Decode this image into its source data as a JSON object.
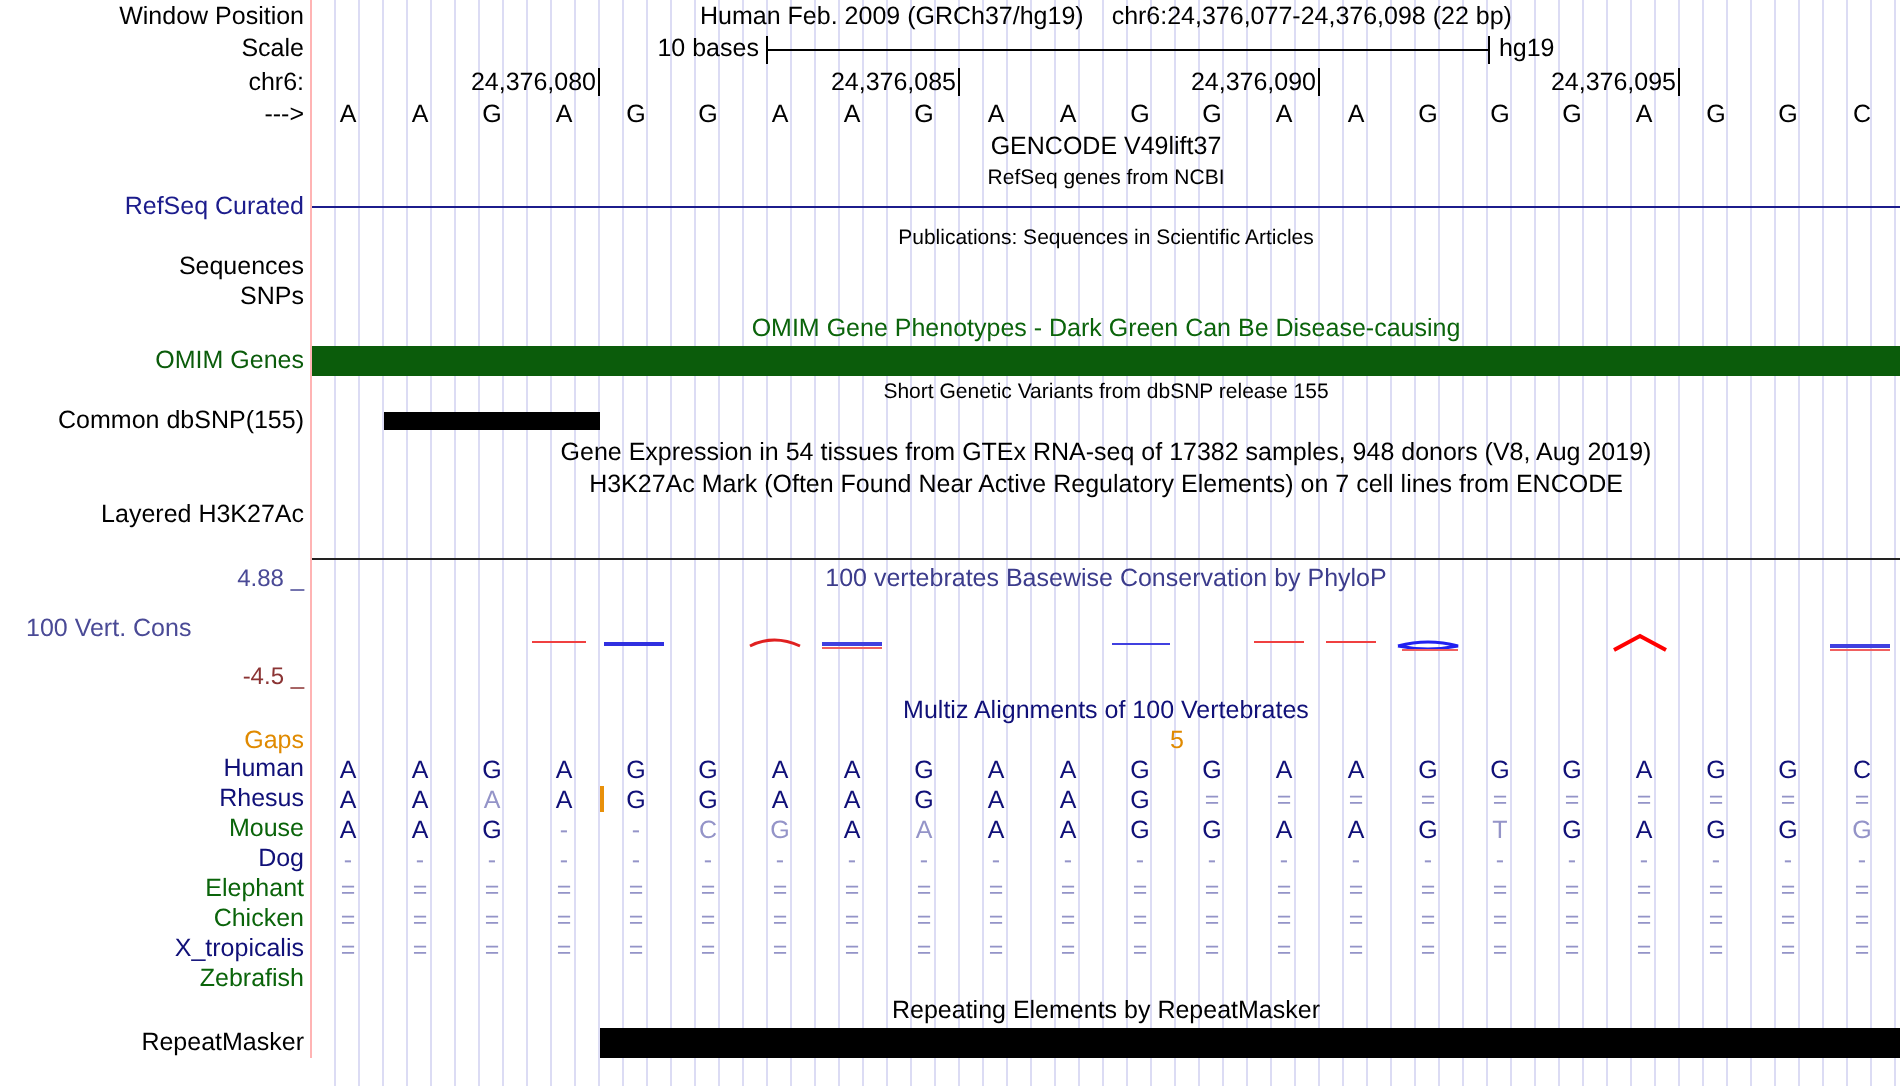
{
  "header": {
    "position_label": "Window Position",
    "assembly": "Human Feb. 2009 (GRCh37/hg19)",
    "position": "chr6:24,376,077-24,376,098 (22 bp)",
    "scale_label": "Scale",
    "scale_text": "10 bases",
    "scale_assembly": "hg19",
    "chrom_label": "chr6:",
    "ruler_ticks": [
      "24,376,080",
      "24,376,085",
      "24,376,090",
      "24,376,095"
    ],
    "strand_label": "--->",
    "bases": [
      "A",
      "A",
      "G",
      "A",
      "G",
      "G",
      "A",
      "A",
      "G",
      "A",
      "A",
      "G",
      "G",
      "A",
      "A",
      "G",
      "G",
      "G",
      "A",
      "G",
      "G",
      "C"
    ]
  },
  "tracks": [
    {
      "kind": "title",
      "text": "GENCODE V49lift37",
      "color": "#000000"
    },
    {
      "kind": "subtitle",
      "text": "RefSeq genes from NCBI"
    },
    {
      "kind": "line",
      "label": "RefSeq Curated",
      "color": "#1c1c8c"
    },
    {
      "kind": "subtitle",
      "text": "Publications: Sequences in Scientific Articles"
    },
    {
      "kind": "label",
      "label": "Sequences"
    },
    {
      "kind": "label",
      "label": "SNPs"
    },
    {
      "kind": "title",
      "text": "OMIM Gene Phenotypes - Dark Green Can Be Disease-causing",
      "color": "#0b640b"
    },
    {
      "kind": "full_bar",
      "label": "OMIM Genes",
      "color": "#0b5c0b"
    },
    {
      "kind": "subtitle",
      "text": "Short Genetic Variants from dbSNP release 155"
    },
    {
      "kind": "snp_bar",
      "label": "Common dbSNP(155)",
      "color": "#000000"
    },
    {
      "kind": "title",
      "text": "Gene Expression in 54 tissues from GTEx RNA-seq of 17382 samples, 948 donors (V8, Aug 2019)",
      "color": "#000000"
    },
    {
      "kind": "title",
      "text": "H3K27Ac Mark (Often Found Near Active Regulatory Elements) on 7 cell lines from ENCODE",
      "color": "#000000"
    },
    {
      "kind": "tall_label",
      "label": "Layered H3K27Ac"
    },
    {
      "kind": "wiggle",
      "label": "100 Vert. Cons",
      "max": "4.88 _",
      "min": "-4.5 _",
      "title": "100 vertebrates Basewise Conservation by PhyloP"
    },
    {
      "kind": "title",
      "text": "Multiz Alignments of 100 Vertebrates",
      "color": "#101078"
    },
    {
      "kind": "gaps",
      "label": "Gaps",
      "count": "5"
    },
    {
      "kind": "species",
      "label": "Human",
      "color": "#101078",
      "bases": [
        "A",
        "A",
        "G",
        "A",
        "G",
        "G",
        "A",
        "A",
        "G",
        "A",
        "A",
        "G",
        "G",
        "A",
        "A",
        "G",
        "G",
        "G",
        "A",
        "G",
        "G",
        "C"
      ],
      "faint": [
        false,
        false,
        false,
        false,
        false,
        false,
        false,
        false,
        false,
        false,
        false,
        false,
        false,
        false,
        false,
        false,
        false,
        false,
        false,
        false,
        false,
        false
      ]
    },
    {
      "kind": "species",
      "label": "Rhesus",
      "color": "#101078",
      "bases": [
        "A",
        "A",
        "A",
        "A",
        "G",
        "G",
        "A",
        "A",
        "G",
        "A",
        "A",
        "G",
        "=",
        "=",
        "=",
        "=",
        "=",
        "=",
        "=",
        "=",
        "=",
        "="
      ],
      "faint": [
        false,
        false,
        true,
        false,
        false,
        false,
        false,
        false,
        false,
        false,
        false,
        false,
        true,
        true,
        true,
        true,
        true,
        true,
        true,
        true,
        true,
        true
      ],
      "insertions": [
        false,
        false,
        false,
        false,
        true,
        false,
        false,
        false,
        false,
        false,
        false,
        false,
        false,
        false,
        false,
        false,
        false,
        false,
        false,
        false,
        false,
        false
      ]
    },
    {
      "kind": "species",
      "label": "Mouse",
      "color": "#0a640a",
      "bases": [
        "A",
        "A",
        "G",
        "-",
        "-",
        "C",
        "G",
        "A",
        "A",
        "A",
        "A",
        "G",
        "G",
        "A",
        "A",
        "G",
        "T",
        "G",
        "A",
        "G",
        "G",
        "G"
      ],
      "faint": [
        false,
        false,
        false,
        true,
        true,
        true,
        true,
        false,
        true,
        false,
        false,
        false,
        false,
        false,
        false,
        false,
        true,
        false,
        false,
        false,
        false,
        true
      ]
    },
    {
      "kind": "species",
      "label": "Dog",
      "color": "#101078",
      "bases": [
        "-",
        "-",
        "-",
        "-",
        "-",
        "-",
        "-",
        "-",
        "-",
        "-",
        "-",
        "-",
        "-",
        "-",
        "-",
        "-",
        "-",
        "-",
        "-",
        "-",
        "-",
        "-"
      ],
      "faint": [
        true,
        true,
        true,
        true,
        true,
        true,
        true,
        true,
        true,
        true,
        true,
        true,
        true,
        true,
        true,
        true,
        true,
        true,
        true,
        true,
        true,
        true
      ]
    },
    {
      "kind": "species",
      "label": "Elephant",
      "color": "#0a640a",
      "bases": [
        "=",
        "=",
        "=",
        "=",
        "=",
        "=",
        "=",
        "=",
        "=",
        "=",
        "=",
        "=",
        "=",
        "=",
        "=",
        "=",
        "=",
        "=",
        "=",
        "=",
        "=",
        "="
      ],
      "faint": [
        true,
        true,
        true,
        true,
        true,
        true,
        true,
        true,
        true,
        true,
        true,
        true,
        true,
        true,
        true,
        true,
        true,
        true,
        true,
        true,
        true,
        true
      ]
    },
    {
      "kind": "species",
      "label": "Chicken",
      "color": "#0a640a",
      "bases": [
        "=",
        "=",
        "=",
        "=",
        "=",
        "=",
        "=",
        "=",
        "=",
        "=",
        "=",
        "=",
        "=",
        "=",
        "=",
        "=",
        "=",
        "=",
        "=",
        "=",
        "=",
        "="
      ],
      "faint": [
        true,
        true,
        true,
        true,
        true,
        true,
        true,
        true,
        true,
        true,
        true,
        true,
        true,
        true,
        true,
        true,
        true,
        true,
        true,
        true,
        true,
        true
      ]
    },
    {
      "kind": "species",
      "label": "X_tropicalis",
      "color": "#101078",
      "bases": [
        "=",
        "=",
        "=",
        "=",
        "=",
        "=",
        "=",
        "=",
        "=",
        "=",
        "=",
        "=",
        "=",
        "=",
        "=",
        "=",
        "=",
        "=",
        "=",
        "=",
        "=",
        "="
      ],
      "faint": [
        true,
        true,
        true,
        true,
        true,
        true,
        true,
        true,
        true,
        true,
        true,
        true,
        true,
        true,
        true,
        true,
        true,
        true,
        true,
        true,
        true,
        true
      ]
    },
    {
      "kind": "species",
      "label": "Zebrafish",
      "color": "#0a640a"
    },
    {
      "kind": "title",
      "text": "Repeating Elements by RepeatMasker",
      "color": "#000000"
    },
    {
      "kind": "repeat_bar",
      "label": "RepeatMasker",
      "color": "#000000"
    }
  ]
}
